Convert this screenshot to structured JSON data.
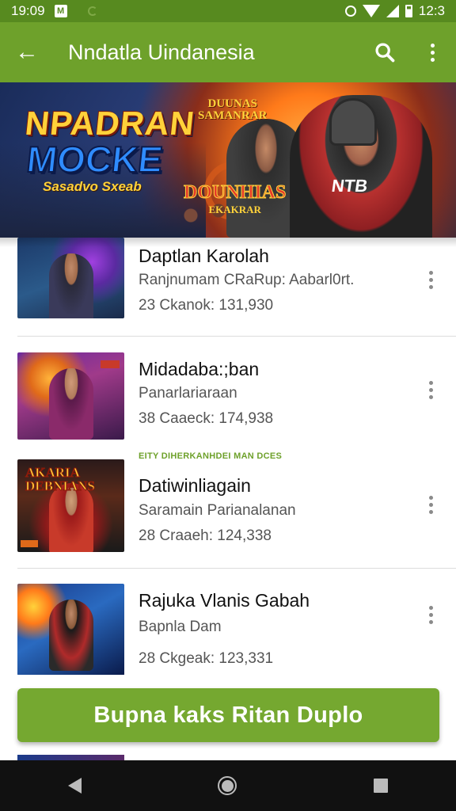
{
  "status_bar": {
    "time": "19:09",
    "battery": "12:3",
    "icons": [
      "notification-icon",
      "alarm-icon",
      "wifi-icon",
      "signal-icon",
      "battery-icon"
    ]
  },
  "app_bar": {
    "title": "Nndatla Uindanesia",
    "icons": [
      "back-arrow-icon",
      "search-icon",
      "more-vert-icon"
    ]
  },
  "banner": {
    "title_line1": "NPADRAN",
    "title_line2": "MOCKE",
    "subtitle": "Sasadvo Sxeab",
    "logo_top_line1": "DUUNAS",
    "logo_top_line2": "SAMANRAR",
    "logo_bottom": "DOUNHIAS",
    "logo_bottom_sub": "EKAKRAR",
    "chest_text": "NTB"
  },
  "list": {
    "items": [
      {
        "title": "Daptlan Karolah",
        "subtitle": "Ranjnumam CRaRup: Aabarl0rt.",
        "meta": "23 Ckanok: 131,930"
      },
      {
        "title": "Midadaba:;ban",
        "subtitle": "Panarlariaraan",
        "meta": "38 Caaeck: 174,938"
      },
      {
        "title": "Datiwinliagain",
        "subtitle": "Saramain Parianalanan",
        "meta": "28 Craaeh: 124,338"
      },
      {
        "title": "Rajuka Vlanis Gabah",
        "subtitle": "Bapnla Dam",
        "meta": "28 Ckgeak: 123,331"
      }
    ],
    "section_label": "EITY DIHERKANHDEI MAN DCES"
  },
  "thumb_logo": {
    "line1": "AKARIA",
    "line2": "DEBNIANS"
  },
  "cta": {
    "label": "Bupna kaks Ritan Duplo"
  },
  "colors": {
    "app_bar": "#6ea12b",
    "status_bar": "#578a1f",
    "cta": "#75a830",
    "nav_bar": "#111111"
  }
}
